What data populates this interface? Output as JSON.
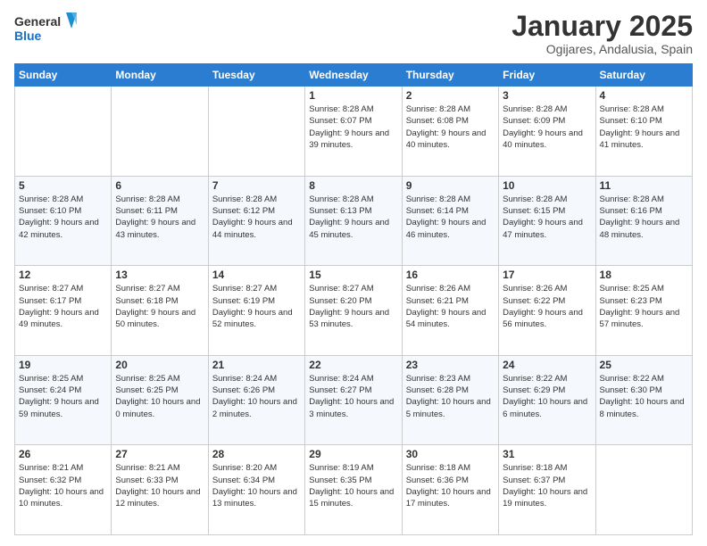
{
  "logo": {
    "line1": "General",
    "line2": "Blue"
  },
  "title": "January 2025",
  "subtitle": "Ogijares, Andalusia, Spain",
  "weekdays": [
    "Sunday",
    "Monday",
    "Tuesday",
    "Wednesday",
    "Thursday",
    "Friday",
    "Saturday"
  ],
  "weeks": [
    [
      {
        "day": "",
        "info": ""
      },
      {
        "day": "",
        "info": ""
      },
      {
        "day": "",
        "info": ""
      },
      {
        "day": "1",
        "info": "Sunrise: 8:28 AM\nSunset: 6:07 PM\nDaylight: 9 hours and 39 minutes."
      },
      {
        "day": "2",
        "info": "Sunrise: 8:28 AM\nSunset: 6:08 PM\nDaylight: 9 hours and 40 minutes."
      },
      {
        "day": "3",
        "info": "Sunrise: 8:28 AM\nSunset: 6:09 PM\nDaylight: 9 hours and 40 minutes."
      },
      {
        "day": "4",
        "info": "Sunrise: 8:28 AM\nSunset: 6:10 PM\nDaylight: 9 hours and 41 minutes."
      }
    ],
    [
      {
        "day": "5",
        "info": "Sunrise: 8:28 AM\nSunset: 6:10 PM\nDaylight: 9 hours and 42 minutes."
      },
      {
        "day": "6",
        "info": "Sunrise: 8:28 AM\nSunset: 6:11 PM\nDaylight: 9 hours and 43 minutes."
      },
      {
        "day": "7",
        "info": "Sunrise: 8:28 AM\nSunset: 6:12 PM\nDaylight: 9 hours and 44 minutes."
      },
      {
        "day": "8",
        "info": "Sunrise: 8:28 AM\nSunset: 6:13 PM\nDaylight: 9 hours and 45 minutes."
      },
      {
        "day": "9",
        "info": "Sunrise: 8:28 AM\nSunset: 6:14 PM\nDaylight: 9 hours and 46 minutes."
      },
      {
        "day": "10",
        "info": "Sunrise: 8:28 AM\nSunset: 6:15 PM\nDaylight: 9 hours and 47 minutes."
      },
      {
        "day": "11",
        "info": "Sunrise: 8:28 AM\nSunset: 6:16 PM\nDaylight: 9 hours and 48 minutes."
      }
    ],
    [
      {
        "day": "12",
        "info": "Sunrise: 8:27 AM\nSunset: 6:17 PM\nDaylight: 9 hours and 49 minutes."
      },
      {
        "day": "13",
        "info": "Sunrise: 8:27 AM\nSunset: 6:18 PM\nDaylight: 9 hours and 50 minutes."
      },
      {
        "day": "14",
        "info": "Sunrise: 8:27 AM\nSunset: 6:19 PM\nDaylight: 9 hours and 52 minutes."
      },
      {
        "day": "15",
        "info": "Sunrise: 8:27 AM\nSunset: 6:20 PM\nDaylight: 9 hours and 53 minutes."
      },
      {
        "day": "16",
        "info": "Sunrise: 8:26 AM\nSunset: 6:21 PM\nDaylight: 9 hours and 54 minutes."
      },
      {
        "day": "17",
        "info": "Sunrise: 8:26 AM\nSunset: 6:22 PM\nDaylight: 9 hours and 56 minutes."
      },
      {
        "day": "18",
        "info": "Sunrise: 8:25 AM\nSunset: 6:23 PM\nDaylight: 9 hours and 57 minutes."
      }
    ],
    [
      {
        "day": "19",
        "info": "Sunrise: 8:25 AM\nSunset: 6:24 PM\nDaylight: 9 hours and 59 minutes."
      },
      {
        "day": "20",
        "info": "Sunrise: 8:25 AM\nSunset: 6:25 PM\nDaylight: 10 hours and 0 minutes."
      },
      {
        "day": "21",
        "info": "Sunrise: 8:24 AM\nSunset: 6:26 PM\nDaylight: 10 hours and 2 minutes."
      },
      {
        "day": "22",
        "info": "Sunrise: 8:24 AM\nSunset: 6:27 PM\nDaylight: 10 hours and 3 minutes."
      },
      {
        "day": "23",
        "info": "Sunrise: 8:23 AM\nSunset: 6:28 PM\nDaylight: 10 hours and 5 minutes."
      },
      {
        "day": "24",
        "info": "Sunrise: 8:22 AM\nSunset: 6:29 PM\nDaylight: 10 hours and 6 minutes."
      },
      {
        "day": "25",
        "info": "Sunrise: 8:22 AM\nSunset: 6:30 PM\nDaylight: 10 hours and 8 minutes."
      }
    ],
    [
      {
        "day": "26",
        "info": "Sunrise: 8:21 AM\nSunset: 6:32 PM\nDaylight: 10 hours and 10 minutes."
      },
      {
        "day": "27",
        "info": "Sunrise: 8:21 AM\nSunset: 6:33 PM\nDaylight: 10 hours and 12 minutes."
      },
      {
        "day": "28",
        "info": "Sunrise: 8:20 AM\nSunset: 6:34 PM\nDaylight: 10 hours and 13 minutes."
      },
      {
        "day": "29",
        "info": "Sunrise: 8:19 AM\nSunset: 6:35 PM\nDaylight: 10 hours and 15 minutes."
      },
      {
        "day": "30",
        "info": "Sunrise: 8:18 AM\nSunset: 6:36 PM\nDaylight: 10 hours and 17 minutes."
      },
      {
        "day": "31",
        "info": "Sunrise: 8:18 AM\nSunset: 6:37 PM\nDaylight: 10 hours and 19 minutes."
      },
      {
        "day": "",
        "info": ""
      }
    ]
  ]
}
